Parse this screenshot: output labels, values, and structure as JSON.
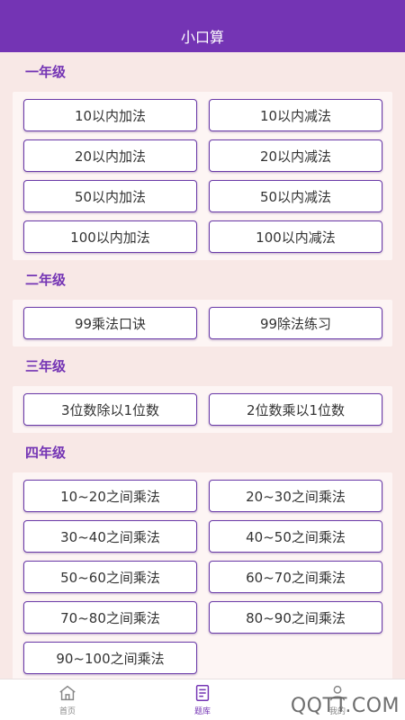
{
  "header": {
    "title": "小口算"
  },
  "grades": [
    {
      "title": "一年级",
      "items": [
        "10以内加法",
        "10以内减法",
        "20以内加法",
        "20以内减法",
        "50以内加法",
        "50以内减法",
        "100以内加法",
        "100以内减法"
      ]
    },
    {
      "title": "二年级",
      "items": [
        "99乘法口诀",
        "99除法练习"
      ]
    },
    {
      "title": "三年级",
      "items": [
        "3位数除以1位数",
        "2位数乘以1位数"
      ]
    },
    {
      "title": "四年级",
      "items": [
        "10~20之间乘法",
        "20~30之间乘法",
        "30~40之间乘法",
        "40~50之间乘法",
        "50~60之间乘法",
        "60~70之间乘法",
        "70~80之间乘法",
        "80~90之间乘法",
        "90~100之间乘法"
      ]
    }
  ],
  "tabbar": {
    "tabs": [
      {
        "label": "首页",
        "icon": "home-icon"
      },
      {
        "label": "题库",
        "icon": "question-bank-icon"
      },
      {
        "label": "我的",
        "icon": "user-icon"
      }
    ],
    "active_index": 1
  },
  "watermark": "QQTT.COM",
  "colors": {
    "primary": "#7434b4",
    "background": "#f8e8e6"
  }
}
